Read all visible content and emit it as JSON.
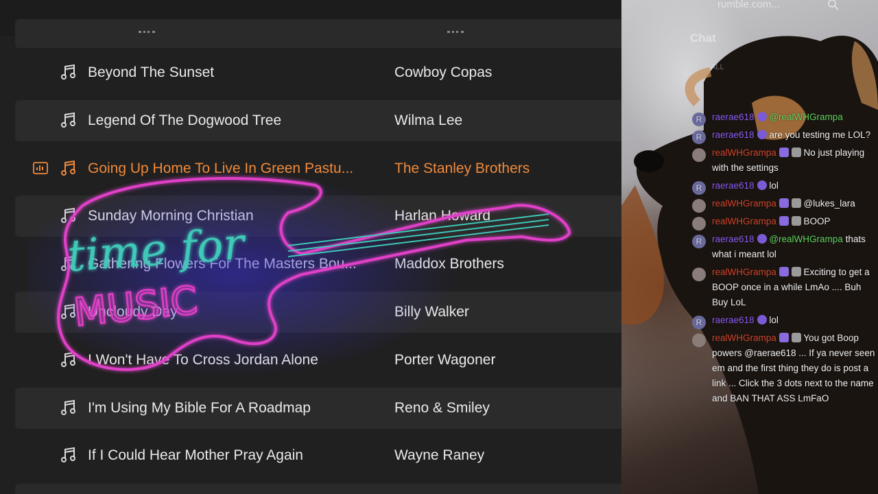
{
  "playlist": {
    "tracks": [
      {
        "title": "Beyond The Sunset",
        "artist": "Cowboy Copas",
        "shaded": false,
        "active": false
      },
      {
        "title": "Legend Of The Dogwood Tree",
        "artist": "Wilma Lee",
        "shaded": true,
        "active": false
      },
      {
        "title": "Going Up Home To Live In Green Pastu...",
        "artist": "The Stanley Brothers",
        "shaded": false,
        "active": true
      },
      {
        "title": "Sunday Morning Christian",
        "artist": "Harlan Howard",
        "shaded": true,
        "active": false
      },
      {
        "title": "Gathering Flowers For The Masters Bou...",
        "artist": "Maddox Brothers",
        "shaded": false,
        "active": false
      },
      {
        "title": "Uncloudy Day",
        "artist": "Billy Walker",
        "shaded": true,
        "active": false
      },
      {
        "title": "I Won't Have To Cross Jordan Alone",
        "artist": "Porter Wagoner",
        "shaded": false,
        "active": false
      },
      {
        "title": "I'm Using My Bible For A Roadmap",
        "artist": "Reno & Smiley",
        "shaded": true,
        "active": false
      },
      {
        "title": "If I Could Hear Mother Pray Again",
        "artist": "Wayne Raney",
        "shaded": false,
        "active": false
      }
    ],
    "accent_color": "#f08a3c",
    "icons": {
      "track": "music-note-icon",
      "now_playing": "now-playing-icon"
    }
  },
  "overlay": {
    "line1": "time for",
    "line2": "MUSIC",
    "colors": {
      "outline": "#e040c8",
      "text": "#3fc8b8"
    }
  },
  "stream": {
    "site": "rumble.com...",
    "chat_tab": "Chat",
    "chat_filter": "ALL",
    "messages": [
      {
        "avatar": "R",
        "user": "raerae618",
        "badges": [
          "badge"
        ],
        "mention": "@realWHGrampa",
        "text": ""
      },
      {
        "avatar": "R",
        "user": "raerae618",
        "badges": [
          "badge"
        ],
        "mention": "",
        "text": "are you testing me LOL?"
      },
      {
        "avatar": "",
        "user": "realWHGrampa",
        "badges": [
          "sq",
          "bx"
        ],
        "mention": "",
        "text": "No just playing with the settings"
      },
      {
        "avatar": "R",
        "user": "raerae618",
        "badges": [
          "badge"
        ],
        "mention": "",
        "text": "lol"
      },
      {
        "avatar": "",
        "user": "realWHGrampa",
        "badges": [
          "sq",
          "bx"
        ],
        "mention": "",
        "text": "@lukes_lara"
      },
      {
        "avatar": "",
        "user": "realWHGrampa",
        "badges": [
          "sq",
          "bx"
        ],
        "mention": "",
        "text": "BOOP"
      },
      {
        "avatar": "R",
        "user": "raerae618",
        "badges": [
          "badge"
        ],
        "mention": "@realWHGrampa",
        "text": "thats what i meant lol"
      },
      {
        "avatar": "",
        "user": "realWHGrampa",
        "badges": [
          "sq",
          "bx"
        ],
        "mention": "",
        "text": "Exciting to get a BOOP once in a while LmAo .... Buh Buy LoL"
      },
      {
        "avatar": "R",
        "user": "raerae618",
        "badges": [
          "badge"
        ],
        "mention": "",
        "text": "lol"
      },
      {
        "avatar": "",
        "user": "realWHGrampa",
        "badges": [
          "sq",
          "bx"
        ],
        "mention": "",
        "text": "You got Boop powers @raerae618 ... If ya never seen em and the first thing they do is post a link ... Click the 3 dots next to the name and BAN THAT ASS LmFaO"
      }
    ]
  }
}
